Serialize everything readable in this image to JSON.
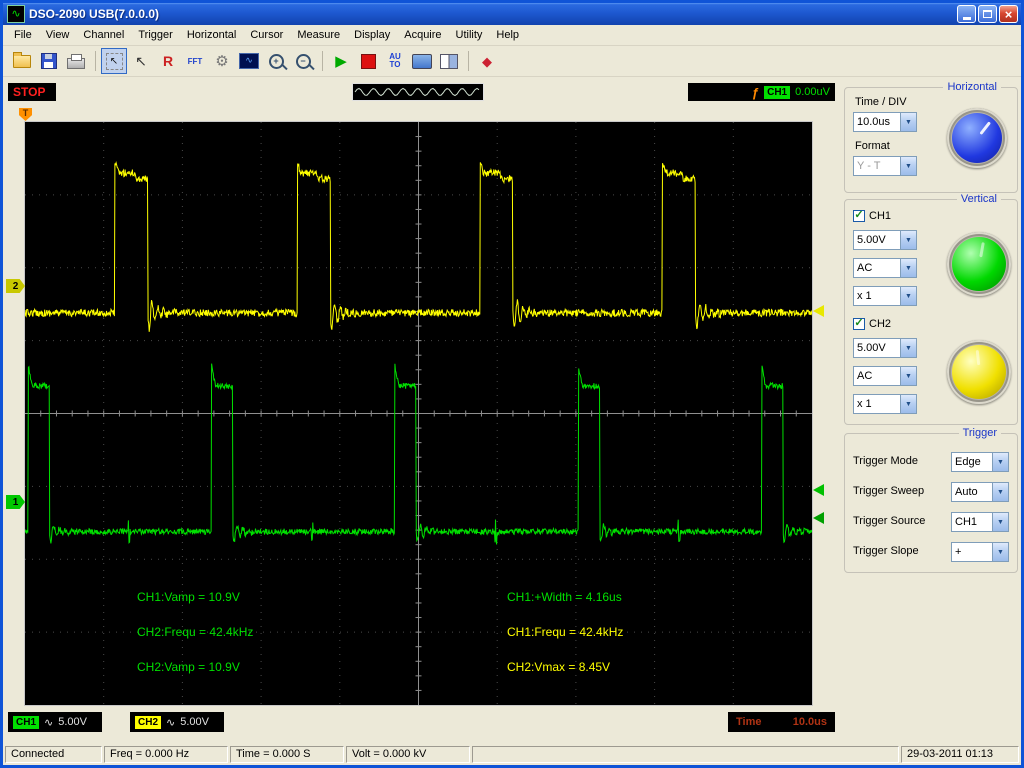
{
  "window": {
    "title": "DSO-2090 USB(7.0.0.0)"
  },
  "menu": {
    "items": [
      "File",
      "View",
      "Channel",
      "Trigger",
      "Horizontal",
      "Cursor",
      "Measure",
      "Display",
      "Acquire",
      "Utility",
      "Help"
    ]
  },
  "toolbar": {
    "r_label": "R",
    "fft_label": "FFT",
    "auto_top": "AU",
    "auto_bottom": "TO",
    "wave_glyph": "∿"
  },
  "status_strip": {
    "run_state": "STOP",
    "trigger_symbol": "ƒ",
    "trigger_channel": "CH1",
    "trigger_level": "0.00uV"
  },
  "scope": {
    "top_marker": "T",
    "left_markers": [
      {
        "label": "2",
        "color": "#c8c800"
      },
      {
        "label": "1",
        "color": "#00c800"
      }
    ],
    "right_markers": [
      {
        "color": "#e8e800"
      },
      {
        "color": "#00c000"
      },
      {
        "color": "#00a000"
      }
    ],
    "measurements": {
      "left": [
        {
          "text": "CH1:Vamp = 10.9V",
          "color": "#00e000"
        },
        {
          "text": "CH2:Frequ = 42.4kHz",
          "color": "#00e000"
        },
        {
          "text": "CH2:Vamp = 10.9V",
          "color": "#00e000"
        }
      ],
      "right": [
        {
          "text": "CH1:+Width = 4.16us",
          "color": "#00e000"
        },
        {
          "text": "CH1:Frequ = 42.4kHz",
          "color": "#ffff00"
        },
        {
          "text": "CH2:Vmax = 8.45V",
          "color": "#ffff00"
        }
      ]
    }
  },
  "channel_bar": {
    "ch1": {
      "label": "CH1",
      "coupling": "∿",
      "volts": "5.00V",
      "color": "#00e000"
    },
    "ch2": {
      "label": "CH2",
      "coupling": "∿",
      "volts": "5.00V",
      "color": "#ffff00"
    },
    "time": {
      "label": "Time",
      "value": "10.0us"
    }
  },
  "panel": {
    "horizontal": {
      "title": "Horizontal",
      "time_div_label": "Time / DIV",
      "time_div_value": "10.0us",
      "format_label": "Format",
      "format_value": "Y - T"
    },
    "vertical": {
      "title": "Vertical",
      "ch1": {
        "label": "CH1",
        "volts": "5.00V",
        "coupling": "AC",
        "probe": "x 1"
      },
      "ch2": {
        "label": "CH2",
        "volts": "5.00V",
        "coupling": "AC",
        "probe": "x 1"
      }
    },
    "trigger": {
      "title": "Trigger",
      "rows": [
        {
          "label": "Trigger Mode",
          "value": "Edge"
        },
        {
          "label": "Trigger Sweep",
          "value": "Auto"
        },
        {
          "label": "Trigger Source",
          "value": "CH1"
        },
        {
          "label": "Trigger Slope",
          "value": "+"
        }
      ]
    }
  },
  "statusbar": {
    "connection": "Connected",
    "freq": "Freq = 0.000 Hz",
    "time": "Time = 0.000 S",
    "volt": "Volt = 0.000 kV",
    "datetime": "29-03-2011 01:13"
  },
  "chart_data": {
    "type": "line",
    "divisions": {
      "x": 10,
      "y": 8
    },
    "time_per_div": "10.0us",
    "series": [
      {
        "name": "CH2",
        "color": "#ffff00",
        "volts_per_div": "5.00V",
        "baseline_div": 2.62,
        "high_div": 0.7,
        "first_rise_div": 1.14,
        "period_div": 2.32,
        "width_div": 0.42,
        "overshoot_div": 0.15,
        "ring_div": 0.25,
        "noise_div": 0.05,
        "step_div": 0.08
      },
      {
        "name": "CH1",
        "color": "#00e000",
        "volts_per_div": "5.00V",
        "baseline_div": 5.62,
        "high_div": 3.62,
        "first_rise_div": 0.04,
        "period_div": 2.33,
        "width_div": 0.27,
        "overshoot_div": 0.28,
        "ring_div": 0.15,
        "noise_div": 0.04,
        "mid_tick_div": 0.14
      }
    ]
  }
}
